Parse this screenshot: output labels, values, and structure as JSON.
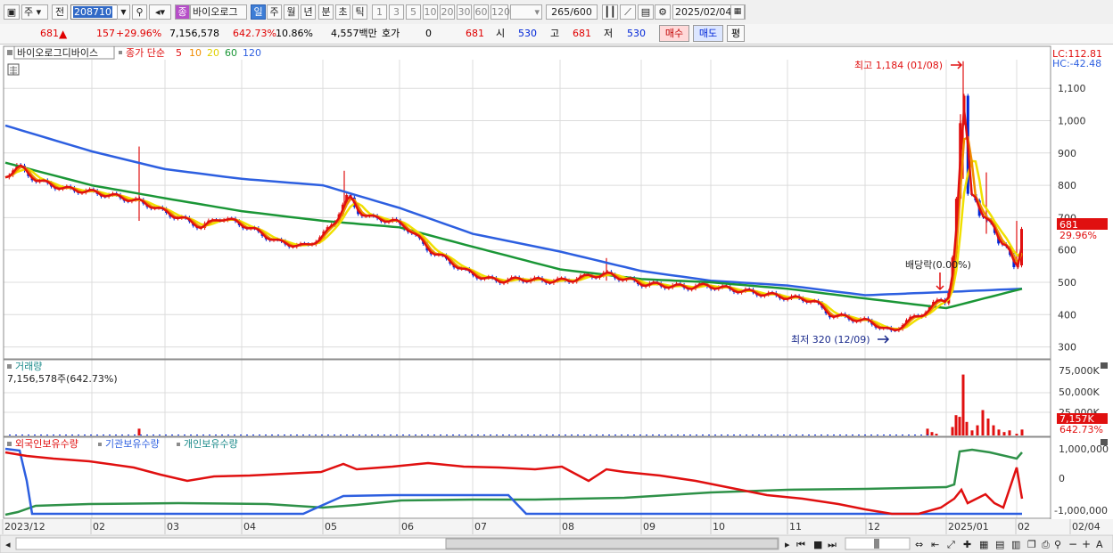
{
  "toolbar": {
    "period_type": "주",
    "jeon_label": "전",
    "stock_code": "208710",
    "stock_name": "바이오로그",
    "stock_name_badge": "종",
    "periods": [
      "일",
      "주",
      "월",
      "년",
      "분",
      "초",
      "틱"
    ],
    "selected_period": "일",
    "intervals": [
      "1",
      "3",
      "5",
      "10",
      "20",
      "30",
      "60",
      "120"
    ],
    "count": "265",
    "count_max": "/600",
    "date": "2025/02/04"
  },
  "quote": {
    "price": "681",
    "change": "157",
    "change_pct": "+29.96%",
    "volume": "7,156,578",
    "volume_ratio": "642.73%",
    "turnover": "10.86%",
    "trade_value": "4,557백만",
    "hoga_label": "호가",
    "hoga_value": "0",
    "hoga_price": "681",
    "open_label": "시",
    "open": "530",
    "high_label": "고",
    "high": "681",
    "low_label": "저",
    "low": "530",
    "buy_label": "매수",
    "sell_label": "매도",
    "avg_label": "평"
  },
  "price_panel": {
    "legend_name": "바이오로그디바이스",
    "legend_ma_label": "종가 단순",
    "ma_periods": [
      "5",
      "10",
      "20",
      "60",
      "120"
    ],
    "ma_colors": [
      "#e01010",
      "#f08c00",
      "#f0e000",
      "#1a9636",
      "#2d5fe0"
    ],
    "lc_label": "LC:112.81",
    "hc_label": "HC:-42.48",
    "high_annotation": "최고 1,184 (01/08)",
    "low_annotation": "최저 320 (12/09)",
    "dividend_annotation": "배당락(0.00%)",
    "last_price_tag": "681",
    "last_change_tag": "29.96%",
    "y_ticks": [
      "1,100",
      "1,000",
      "900",
      "800",
      "700",
      "600",
      "500",
      "400",
      "300"
    ]
  },
  "volume_panel": {
    "title": "거래량",
    "summary": "7,156,578주(642.73%)",
    "y_ticks": [
      "75,000K",
      "50,000K",
      "25,000K"
    ],
    "last_tag": "7,157K",
    "last_pct_tag": "642.73%"
  },
  "holdings_panel": {
    "series_labels": [
      "외국인보유수량",
      "기관보유수량",
      "개인보유수량"
    ],
    "colors": [
      "#e01010",
      "#2d5fe0",
      "#2e9148"
    ],
    "y_ticks": [
      "1,000,000",
      "0",
      "-1,000,000"
    ]
  },
  "x_axis": {
    "labels": [
      "2023/12",
      "02",
      "03",
      "04",
      "05",
      "06",
      "07",
      "08",
      "09",
      "10",
      "11",
      "12",
      "2025/01",
      "02",
      "02/04"
    ]
  },
  "chart_data": {
    "type": "line",
    "x": [
      "2023/12",
      "02",
      "03",
      "04",
      "05",
      "06",
      "07",
      "08",
      "09",
      "10",
      "11",
      "12",
      "2025/01",
      "02"
    ],
    "series": [
      {
        "name": "종가 단순 120",
        "values": [
          985,
          905,
          850,
          820,
          800,
          730,
          650,
          595,
          535,
          505,
          490,
          460,
          470,
          480
        ]
      },
      {
        "name": "종가 단순 60",
        "values": [
          870,
          800,
          760,
          720,
          690,
          670,
          610,
          540,
          510,
          500,
          480,
          450,
          420,
          480
        ]
      }
    ],
    "ylim": [
      270,
      1200
    ],
    "high": 1184,
    "low": 320,
    "last": 681
  }
}
